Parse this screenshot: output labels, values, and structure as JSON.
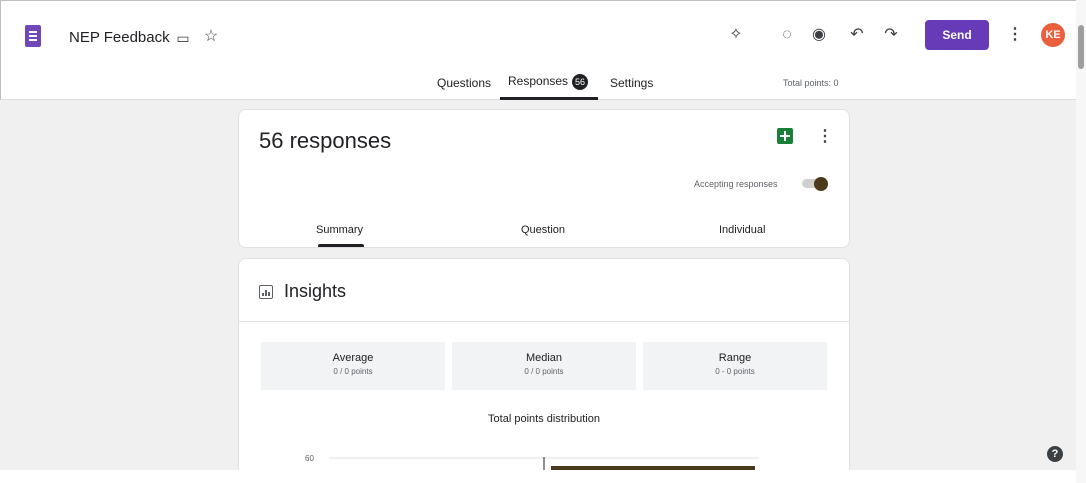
{
  "header": {
    "title": "NEP Feedback",
    "send_label": "Send",
    "avatar_initials": "KE",
    "icons": [
      "folder-icon",
      "star-icon",
      "customize-theme-icon",
      "palette-icon",
      "preview-eye-icon",
      "undo-icon",
      "redo-icon",
      "more-vert-icon"
    ]
  },
  "tabs": {
    "questions": "Questions",
    "responses": "Responses",
    "responses_count": "56",
    "settings": "Settings",
    "total_points": "Total points: 0"
  },
  "responses_card": {
    "title": "56 responses",
    "accepting_label": "Accepting responses",
    "accepting": true,
    "subtabs": {
      "summary": "Summary",
      "question": "Question",
      "individual": "Individual"
    }
  },
  "insights": {
    "title": "Insights",
    "stats": [
      {
        "label": "Average",
        "value": "0 / 0 points"
      },
      {
        "label": "Median",
        "value": "0 / 0 points"
      },
      {
        "label": "Range",
        "value": "0 - 0 points"
      }
    ],
    "distribution_title": "Total points distribution",
    "chart_tick": "60"
  },
  "colors": {
    "accent": "#673ab7",
    "sheets": "#188038",
    "avatar": "#ea5f3c",
    "bar": "#4a3a1c"
  }
}
